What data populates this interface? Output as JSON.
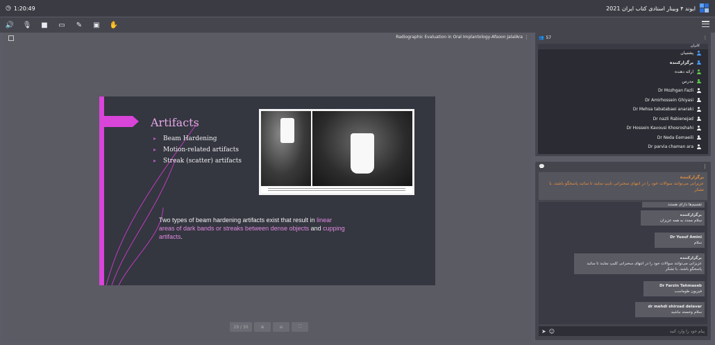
{
  "topbar": {
    "time": "1:20:49",
    "title": "2021 ایوند ۴ وبینار استادی کتاب ایران"
  },
  "stage": {
    "presentation_title": "Radiographic Evaluation in Oral Implantology-Afsoon JalalAra",
    "pager": {
      "page": "29 / 30",
      "zoom_in": "⊕",
      "zoom_out": "⊖",
      "fit": "⛶"
    }
  },
  "slide": {
    "title": "Artifacts",
    "bullets": [
      "Beam Hardening",
      "Motion-related artifacts",
      "Streak (scatter) artifacts"
    ],
    "para_plain1": "Two types of beam hardening artifacts exist that result in ",
    "para_hl1": "linear areas of dark bands or streaks between dense objects",
    "para_plain2": " and ",
    "para_hl2": "cupping artifacts",
    "para_end": "."
  },
  "users": {
    "count": "57",
    "header": "کابران",
    "subheader": "",
    "items": [
      {
        "name": "پشتیبان",
        "color": "#4a9bff"
      },
      {
        "name": "برگزارکننده",
        "color": "#4a9bff",
        "bold": true
      },
      {
        "name": "ارائه دهنده",
        "color": "#5ec94e"
      },
      {
        "name": "مدرس",
        "color": "#5ec94e"
      },
      {
        "name": "Dr Mozhgan Fazli",
        "color": "#f0f0f0"
      },
      {
        "name": "Dr Amirhossein Ghiyasi",
        "color": "#f0f0f0"
      },
      {
        "name": "Dr Mehsa tabatabaei anaraki",
        "color": "#f0f0f0"
      },
      {
        "name": "Dr nazli Rabienejad",
        "color": "#f0f0f0"
      },
      {
        "name": "Dr Hossein Kavousi Khosroshahi",
        "color": "#f0f0f0"
      },
      {
        "name": "Dr Neda Eemaeili",
        "color": "#f0f0f0"
      },
      {
        "name": "Dr parvia chaman ara",
        "color": "#f0f0f0"
      }
    ]
  },
  "chat": {
    "notice_title": "برگزارکننده",
    "notice_text": "عزیزانی می‌توانند سوالات خود را در انتهای سخنرانی تایپ نمایند تا ساتید پاسخگو باشند. با تشکر",
    "messages": [
      {
        "who": "",
        "text": "تقسیم‌ها دارای هستند"
      },
      {
        "who": "برگزارکننده",
        "text": "سلام مجدد به همه عزیزان"
      },
      {
        "who": "Dr Yusuf Amini",
        "text": "سلام"
      },
      {
        "who": "برگزارکننده",
        "text": "عزیزانی می‌توانند سوالات خود را در انتهای سخنرانی کلیپ نمایند تا ساتید پاسخگو باشند. با تشکر"
      },
      {
        "who": "Dr Farzin Tahmaseb",
        "text": "فیزیون طوماسب"
      },
      {
        "who": "dr mehdi shirzad delavar",
        "text": "سلام وخسته نباشید"
      }
    ],
    "input_placeholder": "پیام خود را وارد کنید",
    "send_icon": "send-icon",
    "emoji_icon": "emoji-icon"
  }
}
